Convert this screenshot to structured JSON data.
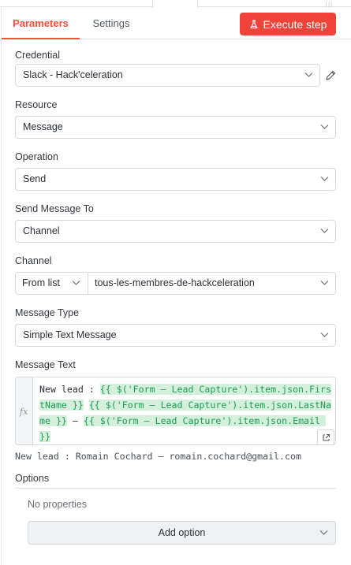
{
  "tabs": {
    "parameters": "Parameters",
    "settings": "Settings"
  },
  "execute_button": "Execute step",
  "credential": {
    "label": "Credential",
    "value": "Slack - Hack'celeration"
  },
  "resource": {
    "label": "Resource",
    "value": "Message"
  },
  "operation": {
    "label": "Operation",
    "value": "Send"
  },
  "send_to": {
    "label": "Send Message To",
    "value": "Channel"
  },
  "channel": {
    "label": "Channel",
    "mode": "From list",
    "value": "tous-les-membres-de-hackceleration"
  },
  "message_type": {
    "label": "Message Type",
    "value": "Simple Text Message"
  },
  "message_text": {
    "label": "Message Text",
    "fx": "fx",
    "prefix": "New lead : ",
    "expr1": "{{ $('Form – Lead Capture').item.json.FirstName }}",
    "space": " ",
    "expr2": "{{ $('Form – Lead Capture').item.json.LastName }}",
    "sep": " – ",
    "expr3": "{{ $('Form – Lead Capture').item.json.Email }}",
    "preview": "New lead : Romain Cochard – romain.cochard@gmail.com"
  },
  "options": {
    "label": "Options",
    "empty": "No properties",
    "add_label": "Add option"
  },
  "colors": {
    "accent": "#ff4f3a",
    "execute_bg": "#f0433a",
    "expression_bg": "#d4f0dc",
    "expression_text": "#1f9d55"
  },
  "icons": {
    "execute": "flask-icon",
    "edit": "pencil-icon",
    "expand": "open-expand-icon",
    "dropdown": "chevron-down-icon"
  }
}
